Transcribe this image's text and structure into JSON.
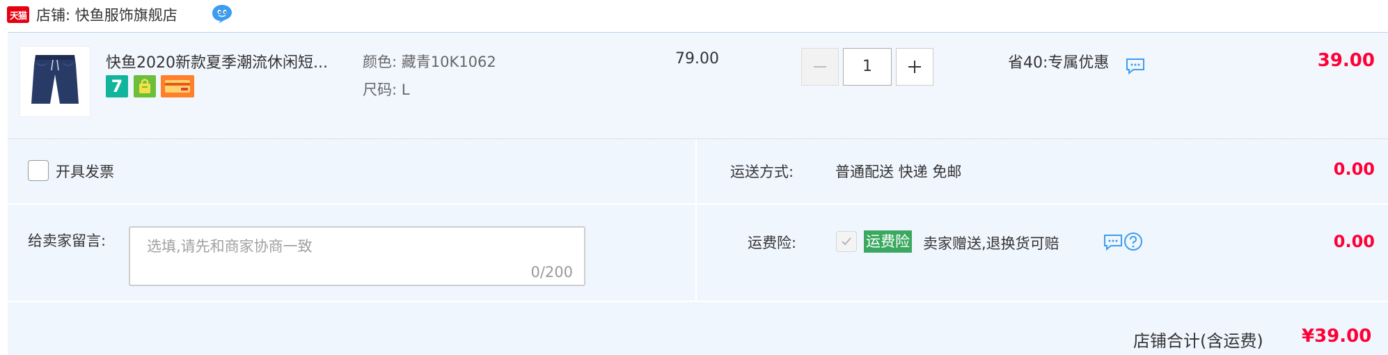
{
  "shop": {
    "badge_text": "天猫",
    "label": "店铺:",
    "name": "快鱼服饰旗舰店"
  },
  "item": {
    "title": "快鱼2020新款夏季潮流休闲短...",
    "service_icons": [
      {
        "name": "seven-day-return-icon",
        "glyph": "7",
        "color": "#12b59b"
      },
      {
        "name": "shopping-bag-icon",
        "color": "#6cbf3a"
      },
      {
        "name": "credit-card-icon",
        "color": "#ff7f2a"
      }
    ],
    "sku": {
      "color_label": "颜色:",
      "color_value": "藏青10K1062",
      "size_label": "尺码:",
      "size_value": "L"
    },
    "unit_price": "79.00",
    "quantity": "1",
    "promo_text": "省40:专属优惠",
    "subtotal": "39.00"
  },
  "invoice": {
    "label": "开具发票",
    "checked": false
  },
  "shipping": {
    "label": "运送方式:",
    "method": "普通配送 快递 免邮",
    "fee": "0.00"
  },
  "message": {
    "label": "给卖家留言:",
    "placeholder": "选填,请先和商家协商一致",
    "counter": "0/200"
  },
  "insurance": {
    "label": "运费险:",
    "badge": "运费险",
    "description": "卖家赠送,退换货可赔",
    "fee": "0.00",
    "checked": true
  },
  "total": {
    "label": "店铺合计(含运费)",
    "amount": "¥39.00"
  },
  "colors": {
    "accent_red": "#ff0036",
    "panel_bg": "#f0f6fe",
    "insurance_green": "#3aa860",
    "link_blue": "#3c9cf0"
  }
}
